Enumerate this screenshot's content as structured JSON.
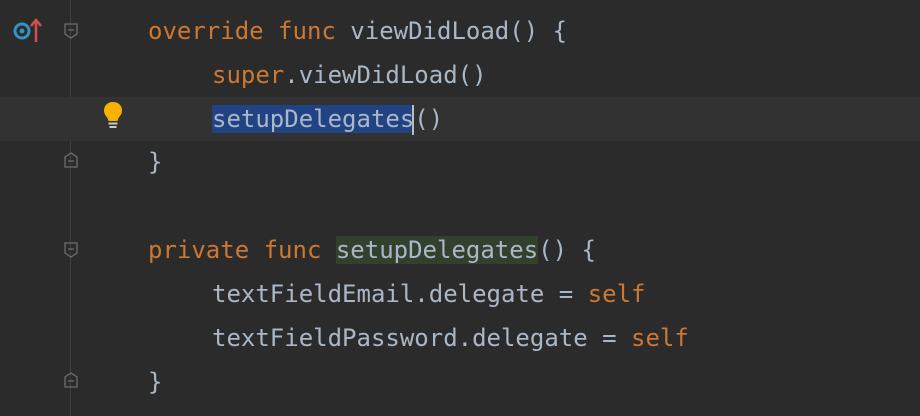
{
  "editor": {
    "lines": [
      {
        "t1": "override",
        "sp1": " ",
        "t2": "func",
        "sp2": " ",
        "t3": "viewDidLoad() {"
      },
      {
        "t1": "super",
        "t2": ".viewDidLoad()"
      },
      {
        "t1": "setupDelegates",
        "t2": "()"
      },
      {
        "t1": "}"
      },
      {
        "t1": "private",
        "sp1": " ",
        "t2": "func",
        "sp2": " ",
        "t3": "setupDelegates",
        "t4": "() {"
      },
      {
        "t1": "textFieldEmail.delegate = ",
        "t2": "self"
      },
      {
        "t1": "textFieldPassword.delegate = ",
        "t2": "self"
      },
      {
        "t1": "}"
      }
    ]
  },
  "colors": {
    "background": "#2b2b2b",
    "keyword": "#cc7832",
    "text": "#a9b7c6",
    "selection": "#214283",
    "usage_highlight": "#32402e",
    "bulb": "#f5b300",
    "override_icon": "#3592c4",
    "override_arrow": "#d05050"
  },
  "icons": [
    "override-method-icon",
    "fold-start-icon",
    "fold-end-icon",
    "intention-bulb-icon"
  ]
}
